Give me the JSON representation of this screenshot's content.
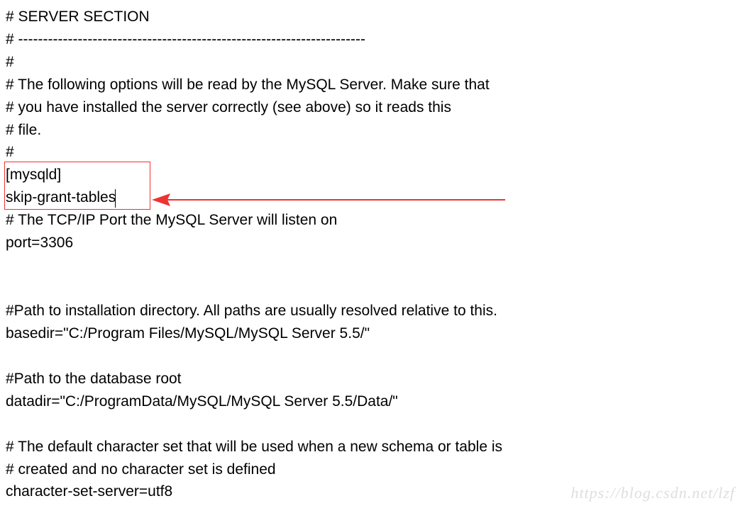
{
  "config": {
    "lines": {
      "l0": "# SERVER SECTION",
      "l1": "# ----------------------------------------------------------------------",
      "l2": "#",
      "l3": "# The following options will be read by the MySQL Server. Make sure that",
      "l4": "# you have installed the server correctly (see above) so it reads this",
      "l5": "# file.",
      "l6": "#",
      "l7": "[mysqld]",
      "l8": "skip-grant-tables",
      "l9": "# The TCP/IP Port the MySQL Server will listen on",
      "l10": "port=3306",
      "l11": "#Path to installation directory. All paths are usually resolved relative to this.",
      "l12": "basedir=\"C:/Program Files/MySQL/MySQL Server 5.5/\"",
      "l13": "#Path to the database root",
      "l14": "datadir=\"C:/ProgramData/MySQL/MySQL Server 5.5/Data/\"",
      "l15": "# The default character set that will be used when a new schema or table is",
      "l16": "# created and no character set is defined",
      "l17": "character-set-server=utf8"
    }
  },
  "watermark": {
    "text": "https://blog.csdn.net/lzf"
  }
}
